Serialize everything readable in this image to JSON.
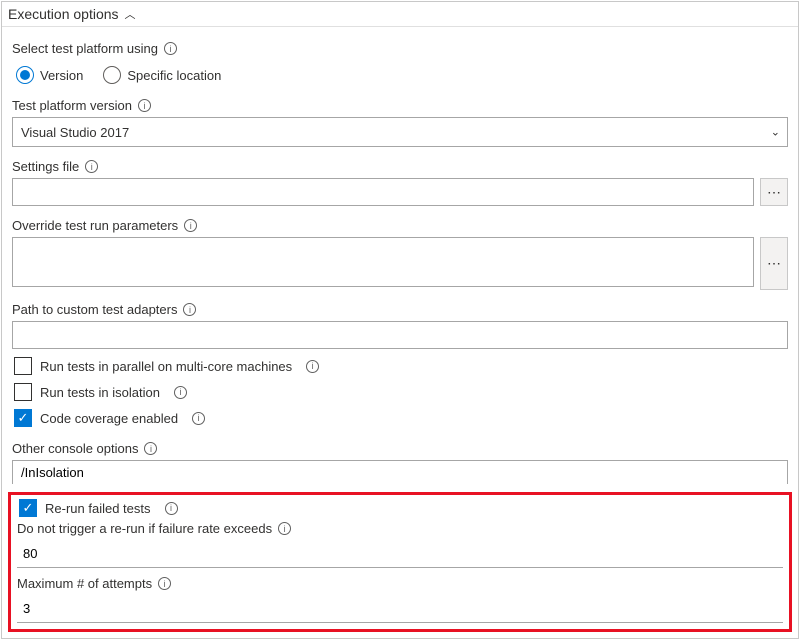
{
  "section": {
    "title": "Execution options"
  },
  "platformSelect": {
    "label": "Select test platform using",
    "options": {
      "version": "Version",
      "specific": "Specific location"
    },
    "selected": "version"
  },
  "platformVersion": {
    "label": "Test platform version",
    "value": "Visual Studio 2017"
  },
  "settingsFile": {
    "label": "Settings file",
    "value": ""
  },
  "overrideParams": {
    "label": "Override test run parameters",
    "value": ""
  },
  "customAdapters": {
    "label": "Path to custom test adapters",
    "value": ""
  },
  "checkboxes": {
    "parallel": {
      "label": "Run tests in parallel on multi-core machines",
      "checked": false
    },
    "isolation": {
      "label": "Run tests in isolation",
      "checked": false
    },
    "coverage": {
      "label": "Code coverage enabled",
      "checked": true
    }
  },
  "consoleOptions": {
    "label": "Other console options",
    "value": "/InIsolation"
  },
  "rerun": {
    "enabledLabel": "Re-run failed tests",
    "failureRateLabel": "Do not trigger a re-run if failure rate exceeds",
    "failureRateValue": "80",
    "maxAttemptsLabel": "Maximum # of attempts",
    "maxAttemptsValue": "3"
  }
}
